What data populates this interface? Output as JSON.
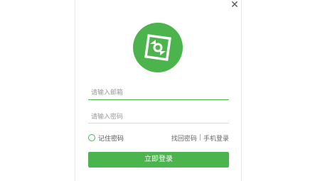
{
  "close_icon": "close-icon",
  "logo": {
    "icon": "app-logo",
    "color": "#4cb44c"
  },
  "form": {
    "email_placeholder": "请输入邮箱",
    "email_value": "",
    "password_placeholder": "请输入密码",
    "password_value": ""
  },
  "remember": {
    "label": "记住密码",
    "checked": false
  },
  "links": {
    "forgot": "找回密码",
    "separator": "|",
    "phone_login": "手机登录"
  },
  "login_button": "立即登录",
  "colors": {
    "accent": "#4cb44c",
    "active_underline": "#4cb44c",
    "inactive_underline": "#d9d9d9"
  }
}
